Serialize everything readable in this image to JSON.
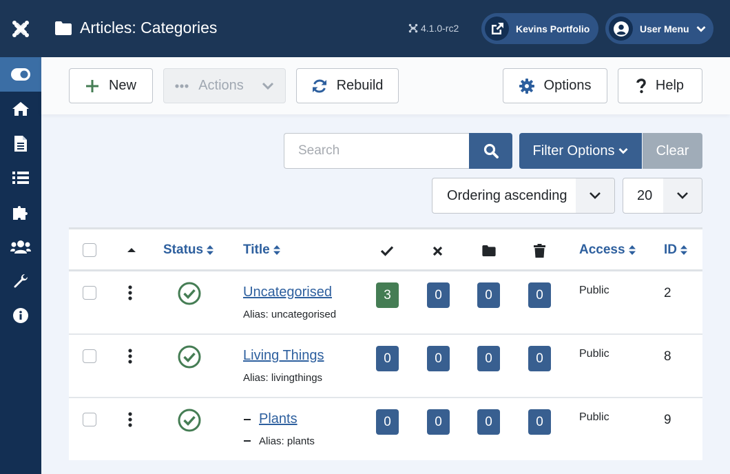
{
  "header": {
    "title": "Articles: Categories",
    "version": "4.1.0-rc2",
    "site_label": "Kevins Portfolio",
    "user_menu_label": "User Menu"
  },
  "sidebar": {
    "items": [
      {
        "icon": "toggle-icon",
        "active": true
      },
      {
        "icon": "home-icon"
      },
      {
        "icon": "file-icon"
      },
      {
        "icon": "list-icon"
      },
      {
        "icon": "puzzle-icon"
      },
      {
        "icon": "users-icon"
      },
      {
        "icon": "wrench-icon"
      },
      {
        "icon": "info-icon"
      }
    ]
  },
  "toolbar": {
    "new_label": "New",
    "actions_label": "Actions",
    "rebuild_label": "Rebuild",
    "options_label": "Options",
    "help_label": "Help"
  },
  "filters": {
    "search_placeholder": "Search",
    "search_value": "",
    "filter_options_label": "Filter Options",
    "clear_label": "Clear",
    "ordering_value": "Ordering ascending",
    "limit_value": "20"
  },
  "table": {
    "headers": {
      "status": "Status",
      "title": "Title",
      "access": "Access",
      "id": "ID"
    },
    "rows": [
      {
        "title": "Uncategorised",
        "alias": "Alias: uncategorised",
        "published": "3",
        "unpublished": "0",
        "archived": "0",
        "trashed": "0",
        "access": "Public",
        "id": "2",
        "level": 1,
        "published_highlight": true
      },
      {
        "title": "Living Things",
        "alias": "Alias: livingthings",
        "published": "0",
        "unpublished": "0",
        "archived": "0",
        "trashed": "0",
        "access": "Public",
        "id": "8",
        "level": 1,
        "published_highlight": false
      },
      {
        "title": "Plants",
        "alias": "Alias: plants",
        "published": "0",
        "unpublished": "0",
        "archived": "0",
        "trashed": "0",
        "access": "Public",
        "id": "9",
        "level": 2,
        "published_highlight": false
      }
    ]
  },
  "colors": {
    "sidebar": "#132f53",
    "header": "#1c3656",
    "primary": "#385f90",
    "success": "#457d54",
    "link": "#2d5f9e"
  }
}
